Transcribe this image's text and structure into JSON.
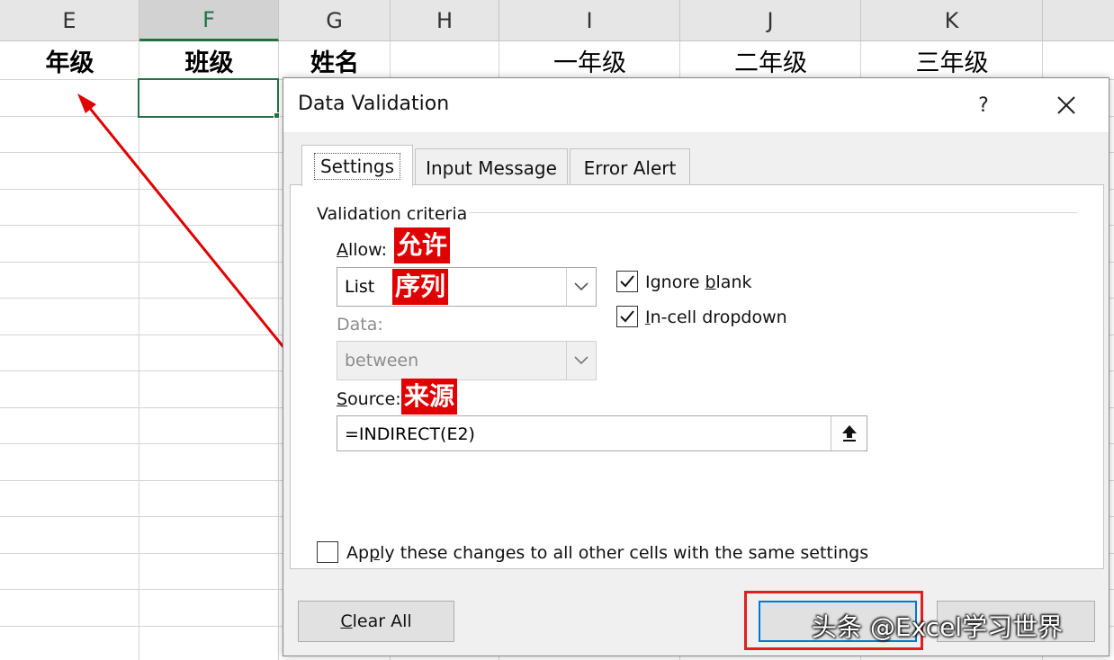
{
  "sheet": {
    "columns": [
      "E",
      "F",
      "G",
      "H",
      "I",
      "J",
      "K"
    ],
    "selected_column": "F",
    "header_row": {
      "E": "年级",
      "F": "班级",
      "G": "姓名",
      "I": "一年级",
      "J": "二年级",
      "K": "三年级"
    }
  },
  "dialog": {
    "title": "Data Validation",
    "help_label": "?",
    "tabs": [
      {
        "label": "Settings",
        "active": true
      },
      {
        "label": "Input Message",
        "active": false
      },
      {
        "label": "Error Alert",
        "active": false
      }
    ],
    "criteria_group": "Validation criteria",
    "allow": {
      "label_key": "A",
      "label_rest": "llow:",
      "value": "List",
      "annotation": "允许"
    },
    "list_annotation": "序列",
    "data": {
      "label": "Data:",
      "value": "between"
    },
    "source": {
      "label_key": "S",
      "label_rest": "ource:",
      "value": "=INDIRECT(E2)",
      "annotation": "来源"
    },
    "ignore_blank": {
      "label_pre": "Ignore ",
      "label_key": "b",
      "label_post": "lank",
      "checked": true
    },
    "in_cell_dropdown": {
      "label_key": "I",
      "label_post": "n-cell dropdown",
      "checked": true
    },
    "apply_all": {
      "label_pre": "Ap",
      "label_key": "p",
      "label_post": "ly these changes to all other cells with the same settings",
      "checked": false
    },
    "clear_all": {
      "label_key": "C",
      "label_post": "lear All"
    }
  },
  "watermark": "头条 @Excel学习世界",
  "colors": {
    "accent_green": "#217346",
    "annotation_red": "#e00000",
    "focus_blue": "#0078d7"
  }
}
